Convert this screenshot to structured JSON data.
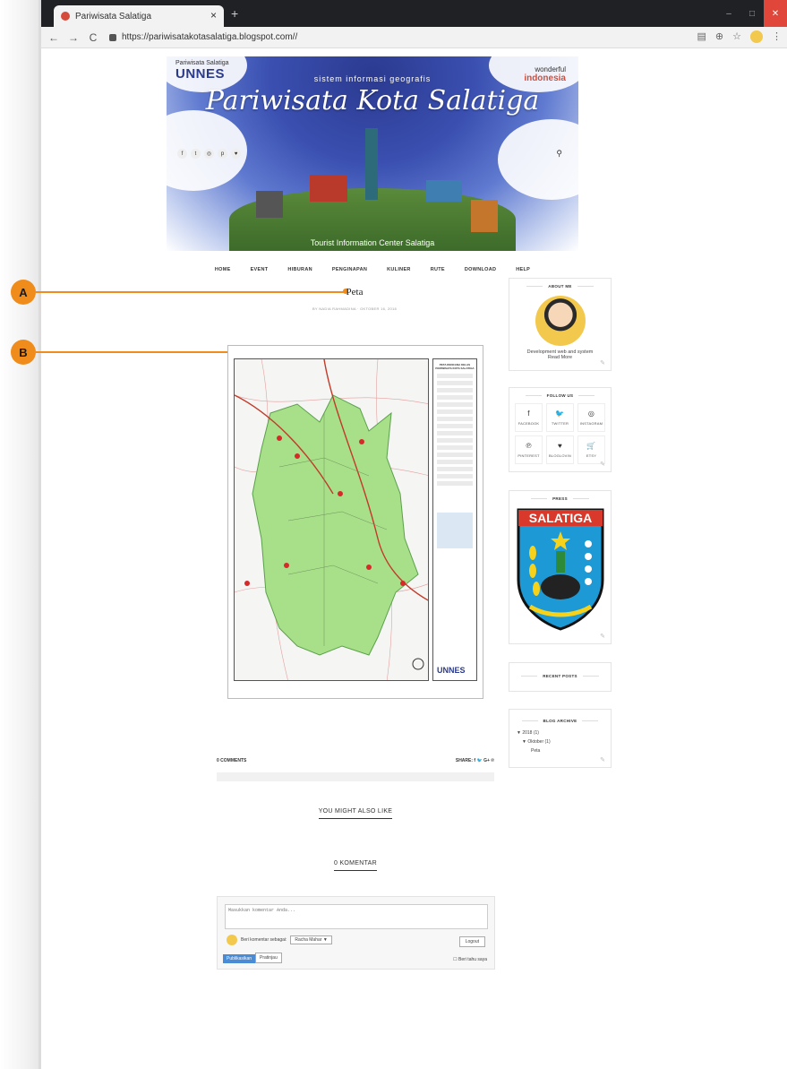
{
  "browser": {
    "tab_title": "Pariwisata Salatiga",
    "tab_close": "×",
    "new_tab": "+",
    "url": "https://pariwisatakotasalatiga.blogspot.com//",
    "back": "←",
    "forward": "→",
    "reload": "C",
    "zoom_icon": "🔍",
    "star": "☆"
  },
  "annotations": {
    "a": "A",
    "b": "B"
  },
  "banner": {
    "left_small": "Pariwisata Salatiga",
    "left_brand": "UNNES",
    "right_small": "wonderful",
    "right_brand": "indonesia",
    "subtitle": "sistem informasi geografis",
    "title": "Pariwisata Kota Salatiga",
    "caption": "Tourist Information Center Salatiga"
  },
  "nav": [
    "HOME",
    "EVENT",
    "HIBURAN",
    "PENGINAPAN",
    "KULINER",
    "RUTE",
    "DOWNLOAD",
    "HELP"
  ],
  "post": {
    "title": "Peta",
    "meta": "BY NADIA RAHMADINA · OKTOBER 16, 2018",
    "comments_count": "0 COMMENTS",
    "share_label": "SHARE:",
    "share_icons": [
      "f",
      "🐦",
      "G+",
      "℗"
    ]
  },
  "map": {
    "legend_title": "PETA RENCANA KELAS PARIWISATA KOTA SALATIGA",
    "brand": "UNNES"
  },
  "sections": {
    "related": "YOU MIGHT ALSO LIKE",
    "komentar": "0 KOMENTAR"
  },
  "comment_form": {
    "placeholder": "Masukkan komentar Anda...",
    "as_label": "Beri komentar sebagai:",
    "user": "Racha Mahar",
    "logout": "Logout",
    "publish": "Publikasikan",
    "preview": "Pratinjau",
    "notify": "Beri tahu saya"
  },
  "sidebar": {
    "about_title": "ABOUT ME",
    "about_text": "Development web and system",
    "read_more": "Read More",
    "follow_title": "FOLLOW US",
    "follow": [
      {
        "icon": "f",
        "label": "FACEBOOK"
      },
      {
        "icon": "🐦",
        "label": "TWITTER"
      },
      {
        "icon": "◎",
        "label": "INSTAGRAM"
      },
      {
        "icon": "℗",
        "label": "PINTEREST"
      },
      {
        "icon": "♥",
        "label": "BLOGLOVIN"
      },
      {
        "icon": "🛒",
        "label": "ETSY"
      }
    ],
    "press_title": "PRESS",
    "crest_text": "SALATIGA",
    "recent_title": "RECENT POSTS",
    "archive_title": "BLOG ARCHIVE",
    "archive_year": "▼  2018 (1)",
    "archive_month": "▼  Oktober (1)",
    "archive_post": "Peta"
  },
  "colors": {
    "annotation": "#f08c1b",
    "accent": "#4a8bd6"
  }
}
